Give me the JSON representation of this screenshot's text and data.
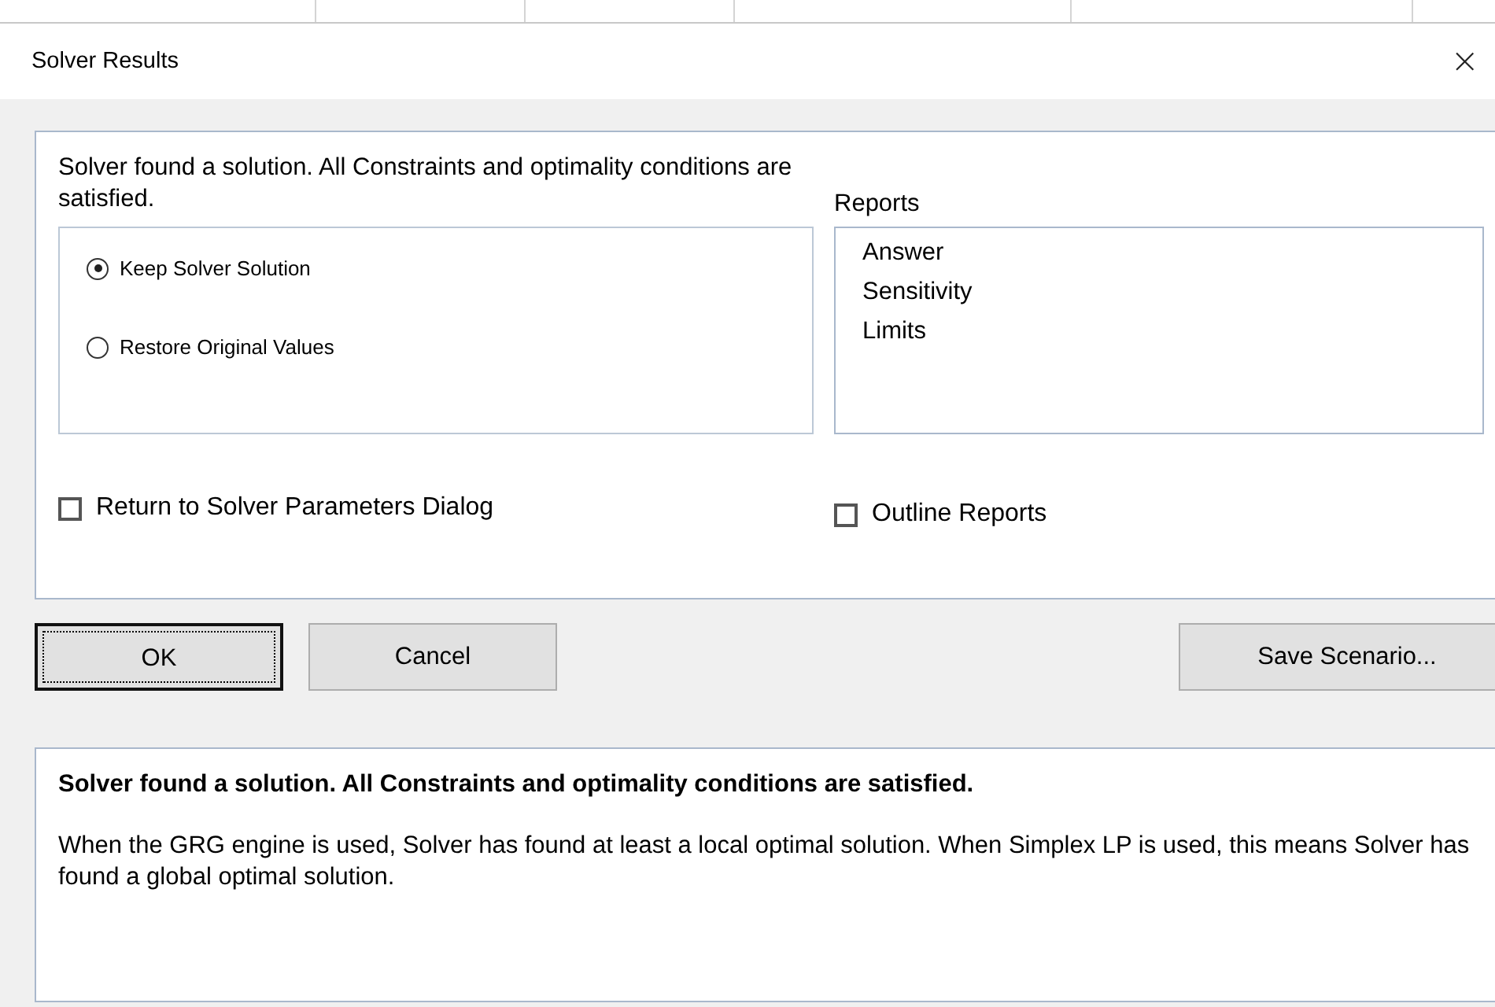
{
  "window": {
    "title": "Solver Results",
    "close": "×"
  },
  "message": "Solver found a solution.  All Constraints and optimality conditions are satisfied.",
  "options": [
    {
      "label": "Keep Solver Solution",
      "selected": true
    },
    {
      "label": "Restore Original Values",
      "selected": false
    }
  ],
  "return_to_dialog": {
    "label": "Return to Solver Parameters Dialog",
    "checked": false
  },
  "reports": {
    "label": "Reports",
    "items": [
      "Answer",
      "Sensitivity",
      "Limits"
    ]
  },
  "outline_reports": {
    "label": "Outline Reports",
    "checked": false
  },
  "buttons": [
    {
      "label": "OK",
      "default": true
    },
    {
      "label": "Cancel",
      "default": false
    }
  ],
  "save_button": "Save Scenario...",
  "details": {
    "heading": "Solver found a solution.  All Constraints and optimality conditions are satisfied.",
    "body": "When the GRG engine is used, Solver has found at least a local optimal solution. When Simplex LP is used, this means Solver has found a global optimal solution."
  }
}
